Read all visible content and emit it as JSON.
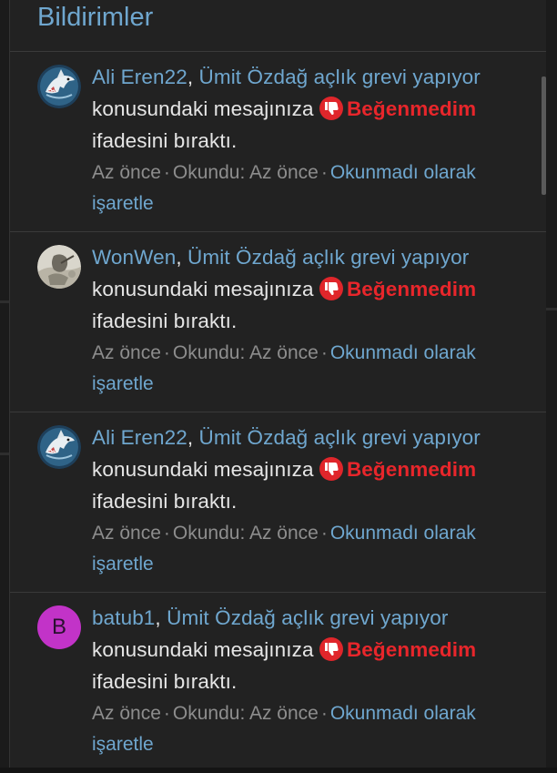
{
  "header": {
    "title": "Bildirimler"
  },
  "notifications": [
    {
      "avatar_icon": "shark-avatar-icon",
      "user": "Ali Eren22",
      "thread": "Ümit Özdağ açlık grevi yapıyor",
      "text_a": "konusundaki mesajınıza",
      "reaction": "Beğenmedim",
      "text_b": "ifadesini bıraktı.",
      "time": "Az önce",
      "read_label": "Okundu: Az önce",
      "mark_unread": "Okunmadı olarak işaretle"
    },
    {
      "avatar_icon": "photo-avatar-icon",
      "user": "WonWen",
      "thread": "Ümit Özdağ açlık grevi yapıyor",
      "text_a": "konusundaki mesajınıza",
      "reaction": "Beğenmedim",
      "text_b": "ifadesini bıraktı.",
      "time": "Az önce",
      "read_label": "Okundu: Az önce",
      "mark_unread": "Okunmadı olarak işaretle"
    },
    {
      "avatar_icon": "shark-avatar-icon",
      "user": "Ali Eren22",
      "thread": "Ümit Özdağ açlık grevi yapıyor",
      "text_a": "konusundaki mesajınıza",
      "reaction": "Beğenmedim",
      "text_b": "ifadesini bıraktı.",
      "time": "Az önce",
      "read_label": "Okundu: Az önce",
      "mark_unread": "Okunmadı olarak işaretle"
    },
    {
      "avatar_letter": "B",
      "user": "batub1",
      "thread": "Ümit Özdağ açlık grevi yapıyor",
      "text_a": "konusundaki mesajınıza",
      "reaction": "Beğenmedim",
      "text_b": "ifadesini bıraktı.",
      "time": "Az önce",
      "read_label": "Okundu: Az önce",
      "mark_unread": "Okunmadı olarak işaretle"
    }
  ],
  "colors": {
    "link": "#6fa7cf",
    "reaction": "#e8262b",
    "panel_bg": "#222222",
    "avatar_letter_bg": "#c233c8"
  }
}
